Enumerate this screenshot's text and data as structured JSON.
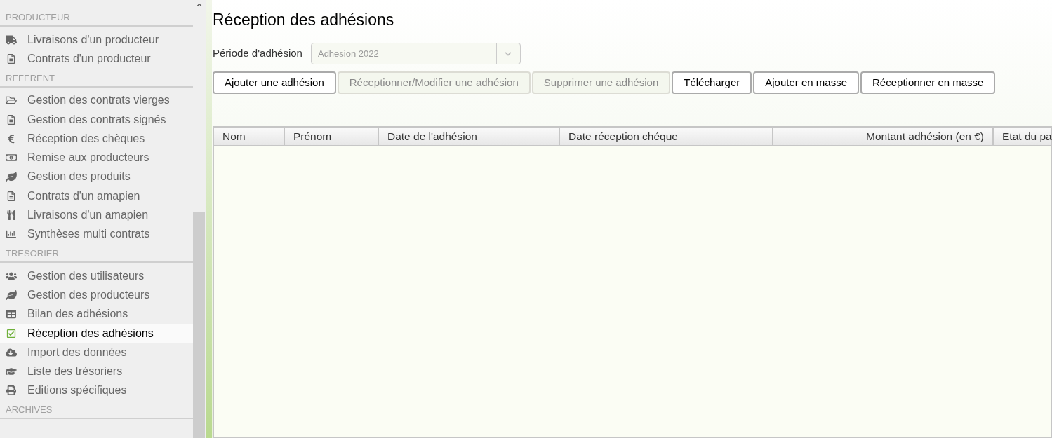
{
  "sidebar": {
    "sections": [
      {
        "title": "PRODUCTEUR",
        "items": [
          {
            "label": "Livraisons d'un producteur",
            "selected": false
          },
          {
            "label": "Contrats d'un producteur",
            "selected": false
          }
        ]
      },
      {
        "title": "REFERENT",
        "items": [
          {
            "label": "Gestion des contrats vierges",
            "selected": false
          },
          {
            "label": "Gestion des contrats signés",
            "selected": false
          },
          {
            "label": "Réception des chèques",
            "selected": false
          },
          {
            "label": "Remise aux producteurs",
            "selected": false
          },
          {
            "label": "Gestion des produits",
            "selected": false
          },
          {
            "label": "Contrats d'un amapien",
            "selected": false
          },
          {
            "label": "Livraisons d'un amapien",
            "selected": false
          },
          {
            "label": "Synthèses multi contrats",
            "selected": false
          }
        ]
      },
      {
        "title": "TRESORIER",
        "items": [
          {
            "label": "Gestion des utilisateurs",
            "selected": false
          },
          {
            "label": "Gestion des producteurs",
            "selected": false
          },
          {
            "label": "Bilan des adhésions",
            "selected": false
          },
          {
            "label": "Réception des adhésions",
            "selected": true
          },
          {
            "label": "Import des données",
            "selected": false
          },
          {
            "label": "Liste des trésoriers",
            "selected": false
          },
          {
            "label": "Editions spécifiques",
            "selected": false
          }
        ]
      },
      {
        "title": "ARCHIVES"
      }
    ]
  },
  "page": {
    "title": "Réception des adhésions",
    "period": {
      "label": "Période d'adhésion",
      "value": "Adhesion 2022",
      "disabled": true
    },
    "buttons": [
      {
        "label": "Ajouter une adhésion",
        "disabled": false
      },
      {
        "label": "Réceptionner/Modifier une adhésion",
        "disabled": true
      },
      {
        "label": "Supprimer une adhésion",
        "disabled": true
      },
      {
        "label": "Télécharger",
        "disabled": false
      },
      {
        "label": "Ajouter en masse",
        "disabled": false
      },
      {
        "label": "Réceptionner en masse",
        "disabled": false
      }
    ],
    "table": {
      "columns": [
        {
          "label": "Nom",
          "numeric": false
        },
        {
          "label": "Prénom",
          "numeric": false
        },
        {
          "label": "Date de l'adhésion",
          "numeric": false
        },
        {
          "label": "Date réception chéque",
          "numeric": false
        },
        {
          "label": "Montant adhésion (en €)",
          "numeric": true
        },
        {
          "label": "Etat du pa",
          "numeric": false
        }
      ]
    }
  }
}
